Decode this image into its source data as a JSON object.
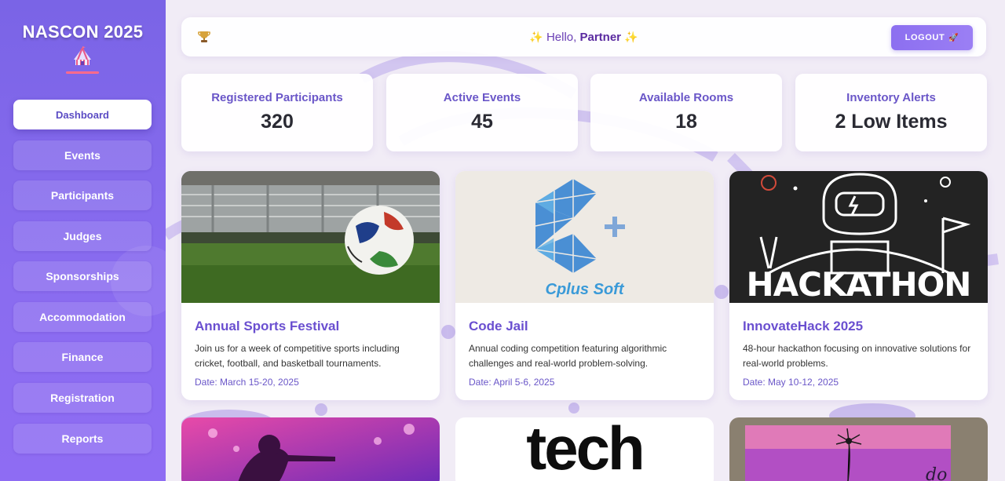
{
  "brand": {
    "title": "NASCON 2025",
    "icon": "circus-tent-icon"
  },
  "sidebar": {
    "items": [
      {
        "label": "Dashboard",
        "active": true
      },
      {
        "label": "Events"
      },
      {
        "label": "Participants"
      },
      {
        "label": "Judges"
      },
      {
        "label": "Sponsorships"
      },
      {
        "label": "Accommodation"
      },
      {
        "label": "Finance"
      },
      {
        "label": "Registration"
      },
      {
        "label": "Reports"
      }
    ]
  },
  "header": {
    "trophy_icon": "trophy-icon",
    "greeting_prefix": "Hello, ",
    "greeting_name": "Partner",
    "logout_label": "LOGOUT",
    "logout_icon": "rocket-icon"
  },
  "stats": [
    {
      "label": "Registered Participants",
      "value": "320"
    },
    {
      "label": "Active Events",
      "value": "45"
    },
    {
      "label": "Available Rooms",
      "value": "18"
    },
    {
      "label": "Inventory Alerts",
      "value": "2 Low Items"
    }
  ],
  "events": [
    {
      "title": "Annual Sports Festival",
      "description": "Join us for a week of competitive sports including cricket, football, and basketball tournaments.",
      "date": "Date: March 15-20, 2025",
      "image": "soccer-ball-stadium"
    },
    {
      "title": "Code Jail",
      "description": "Annual coding competition featuring algorithmic challenges and real-world problem-solving.",
      "date": "Date: April 5-6, 2025",
      "image": "cplus-soft-logo",
      "image_text": "Cplus Soft"
    },
    {
      "title": "InnovateHack 2025",
      "description": "48-hour hackathon focusing on innovative solutions for real-world problems.",
      "date": "Date: May 10-12, 2025",
      "image": "hackathon-astronaut",
      "image_text": "HACKATHON"
    }
  ],
  "more_events": [
    {
      "image": "concert-singer"
    },
    {
      "image": "tech-logo",
      "image_text": "tech"
    },
    {
      "image": "dandelion-sign"
    }
  ],
  "colors": {
    "sidebar": "#7a64e6",
    "accent": "#6a4fd0",
    "background": "#f1ecf6"
  }
}
